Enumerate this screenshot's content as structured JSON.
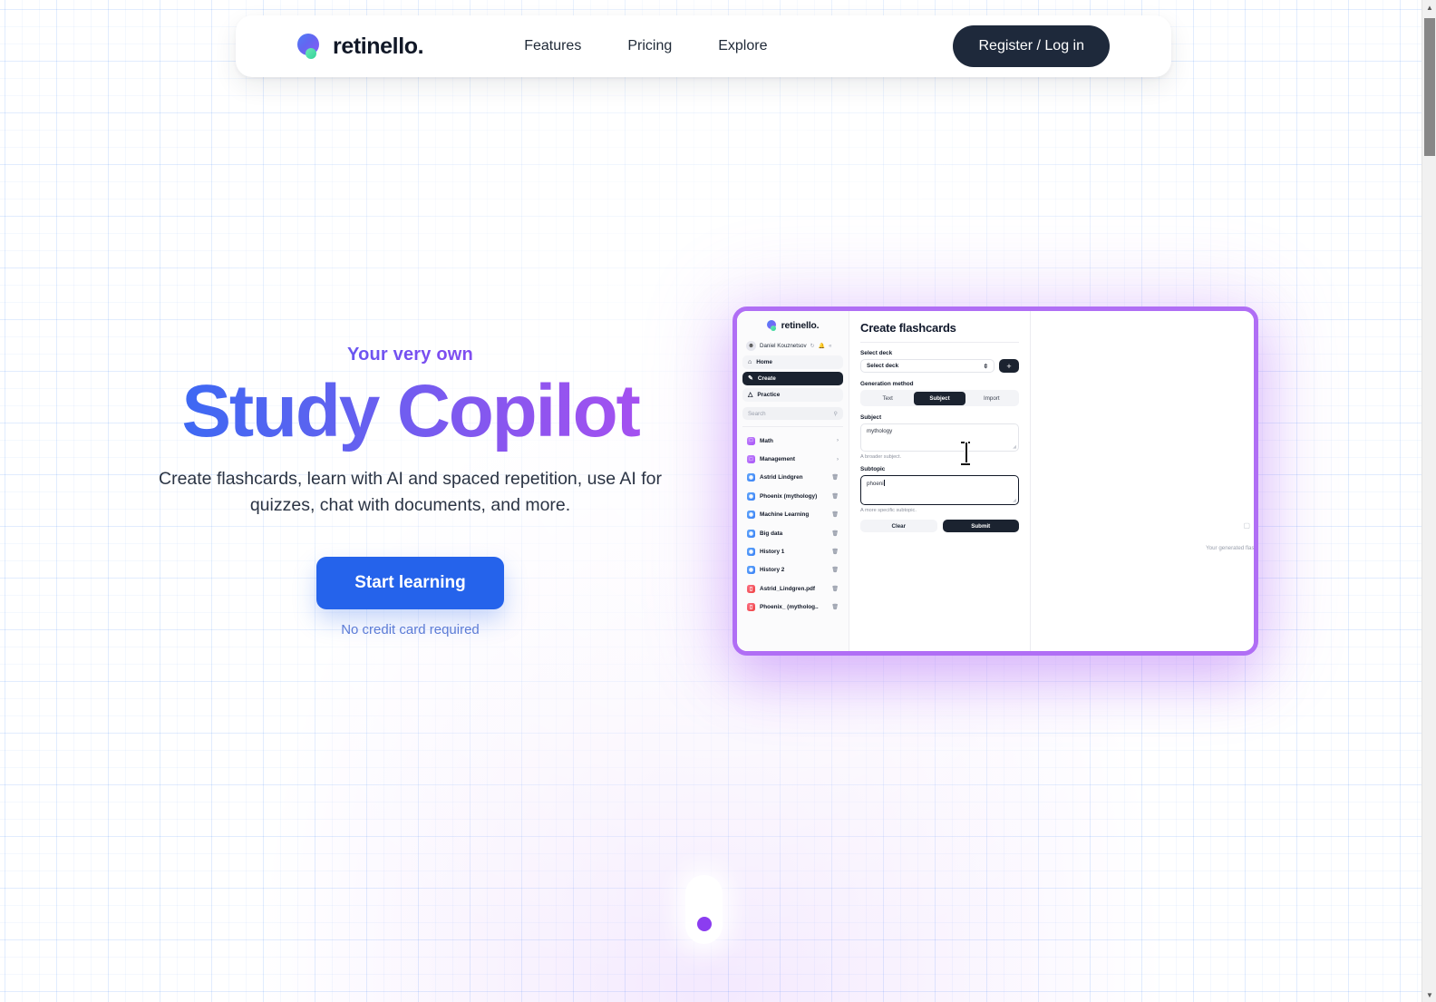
{
  "navbar": {
    "brand": "retinello.",
    "links": [
      {
        "label": "Features"
      },
      {
        "label": "Pricing"
      },
      {
        "label": "Explore"
      }
    ],
    "cta": "Register / Log in"
  },
  "hero": {
    "eyebrow": "Your very own",
    "title": "Study Copilot",
    "subtitle": "Create flashcards, learn with AI and spaced repetition, use AI for quizzes, chat with documents, and more.",
    "cta_label": "Start learning",
    "cta_note": "No credit card required"
  },
  "app_preview": {
    "brand": "retinello.",
    "user": {
      "name": "Daniel Kouznetsov",
      "icons": [
        "refresh-icon",
        "bell-icon",
        "collapse-icon"
      ]
    },
    "nav": [
      {
        "label": "Home",
        "icon": "home-icon",
        "active": false
      },
      {
        "label": "Create",
        "icon": "pencil-icon",
        "active": true
      },
      {
        "label": "Practice",
        "icon": "graduation-icon",
        "active": false
      }
    ],
    "search_placeholder": "Search",
    "decks": [
      {
        "label": "Math",
        "icon": "folder-icon",
        "color": "purple",
        "trail": "chevron-right-icon"
      },
      {
        "label": "Management",
        "icon": "folder-icon",
        "color": "purple",
        "trail": "chevron-right-icon"
      },
      {
        "label": "Astrid Lindgren",
        "icon": "deck-icon",
        "color": "blue",
        "trail": "trash-icon"
      },
      {
        "label": "Phoenix (mythology)",
        "icon": "deck-icon",
        "color": "blue",
        "trail": "trash-icon"
      },
      {
        "label": "Machine Learning",
        "icon": "deck-icon",
        "color": "blue",
        "trail": "trash-icon"
      },
      {
        "label": "Big data",
        "icon": "deck-icon",
        "color": "blue",
        "trail": "trash-icon"
      },
      {
        "label": "History 1",
        "icon": "deck-icon",
        "color": "blue",
        "trail": "trash-icon"
      },
      {
        "label": "History 2",
        "icon": "deck-icon",
        "color": "blue",
        "trail": "trash-icon"
      },
      {
        "label": "Astrid_Lindgren.pdf",
        "icon": "pdf-icon",
        "color": "red",
        "trail": "trash-icon"
      },
      {
        "label": "Phoenix_ (mytholog..",
        "icon": "pdf-icon",
        "color": "red",
        "trail": "trash-icon"
      }
    ],
    "form": {
      "title": "Create flashcards",
      "select_deck_label": "Select deck",
      "select_deck_value": "Select deck",
      "add_deck_label": "+",
      "generation_method_label": "Generation method",
      "methods": [
        {
          "label": "Text",
          "selected": false
        },
        {
          "label": "Subject",
          "selected": true
        },
        {
          "label": "Import",
          "selected": false
        }
      ],
      "subject_label": "Subject",
      "subject_value": "mythology",
      "subject_help": "A broader subject.",
      "subtopic_label": "Subtopic",
      "subtopic_value": "phoeni",
      "subtopic_help": "A more specific subtopic.",
      "clear_label": "Clear",
      "submit_label": "Submit"
    },
    "result_note": "Your generated flash"
  },
  "colors": {
    "accent_blue": "#2563eb",
    "accent_purple": "#b06ef5",
    "dark": "#1e293b"
  }
}
